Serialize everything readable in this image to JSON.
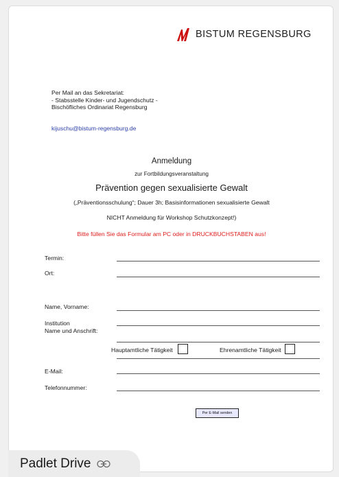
{
  "header": {
    "brand_text": "BISTUM REGENSBURG",
    "brand_color": "#cc1010"
  },
  "recipient": {
    "lines": [
      "Per Mail an das Sekretariat:",
      "- Stabsstelle Kinder- und Jugendschutz -",
      "Bischöfliches Ordinariat Regensburg"
    ],
    "email": "kijuschu@bistum-regensburg.de"
  },
  "heading": {
    "title": "Anmeldung",
    "subtitle": "zur Fortbildungsveranstaltung",
    "main": "Prävention gegen sexualisierte Gewalt",
    "note": "(„Präventionsschulung“; Dauer 3h; Basisinformationen sexualisierte Gewalt",
    "not_registration": "NICHT Anmeldung für Workshop Schutzkonzept!)",
    "warning": "Bitte füllen Sie das Formular am PC oder in DRUCKBUCHSTABEN aus!"
  },
  "form": {
    "termin_label": "Termin:",
    "ort_label": "Ort:",
    "name_label": "Name, Vorname:",
    "institution_label_1": "Institution",
    "institution_label_2": "Name und Anschrift:",
    "hauptamtlich_label": "Hauptamtliche Tätigkeit",
    "ehrenamtlich_label": "Ehrenamtliche Tätigkeit",
    "email_label": "E-Mail:",
    "telefon_label": "Telefonnummer:",
    "send_button": "Per E-Mail senden"
  },
  "footer": {
    "label": "Padlet Drive",
    "icon": "link-icon"
  },
  "colors": {
    "accent_red": "#e01b1b",
    "link_blue": "#2b3fa8",
    "button_bg": "#e8e8ff"
  }
}
